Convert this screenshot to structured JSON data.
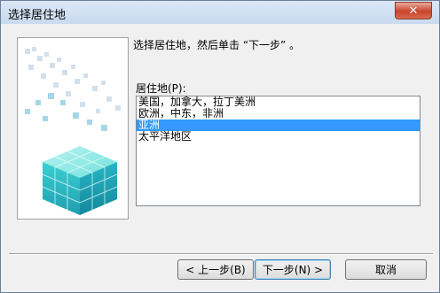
{
  "window": {
    "title": "选择居住地",
    "close_glyph": "✕"
  },
  "instruction": "选择居住地，然后单击 “下一步” 。",
  "residence": {
    "label": "居住地(P):",
    "items": [
      {
        "label": "美国，加拿大，拉丁美洲",
        "selected": false
      },
      {
        "label": "欧洲，中东，非洲",
        "selected": false
      },
      {
        "label": "亚洲",
        "selected": true
      },
      {
        "label": "太平洋地区",
        "selected": false
      }
    ]
  },
  "buttons": {
    "back": "< 上一步(B)",
    "next": "下一步(N) >",
    "cancel": "取消"
  },
  "colors": {
    "selection": "#3399ff",
    "cube_accent": "#2cc7c7"
  }
}
